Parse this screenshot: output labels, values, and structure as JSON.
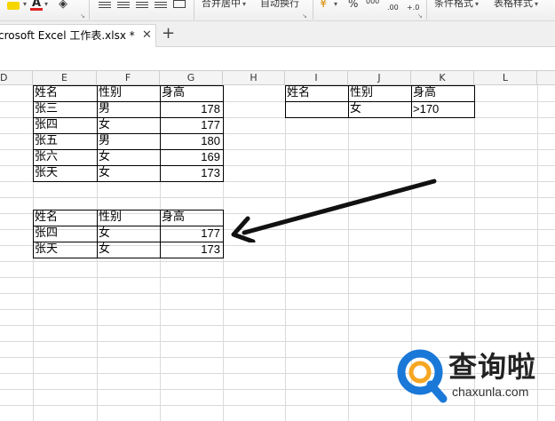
{
  "ribbon": {
    "merge_label": "合并居中",
    "wrap_label": "自动换行",
    "percent_symbol": "%",
    "comma_symbol": "000",
    "dec_inc": ".00",
    "dec_dec": "+.0",
    "cond_format_label": "条件格式",
    "table_style_label": "表格样式"
  },
  "document_tab": {
    "title": "crosoft Excel 工作表.xlsx *",
    "close_symbol": "✕",
    "new_tab_symbol": "+"
  },
  "columns": [
    "D",
    "E",
    "F",
    "G",
    "H",
    "I",
    "J",
    "K",
    "L"
  ],
  "source_table": {
    "headers": [
      "姓名",
      "性别",
      "身高"
    ],
    "rows": [
      [
        "张三",
        "男",
        "178"
      ],
      [
        "张四",
        "女",
        "177"
      ],
      [
        "张五",
        "男",
        "180"
      ],
      [
        "张六",
        "女",
        "169"
      ],
      [
        "张天",
        "女",
        "173"
      ]
    ]
  },
  "criteria_table": {
    "headers": [
      "姓名",
      "性别",
      "身高"
    ],
    "row": [
      "",
      "女",
      ">170"
    ]
  },
  "result_table": {
    "headers": [
      "姓名",
      "性别",
      "身高"
    ],
    "rows": [
      [
        "张四",
        "女",
        "177"
      ],
      [
        "张天",
        "女",
        "173"
      ]
    ]
  },
  "watermark": {
    "text": "查询啦",
    "url": "chaxunla.com",
    "color_blue": "#1a78d8",
    "color_orange": "#f5a623"
  }
}
